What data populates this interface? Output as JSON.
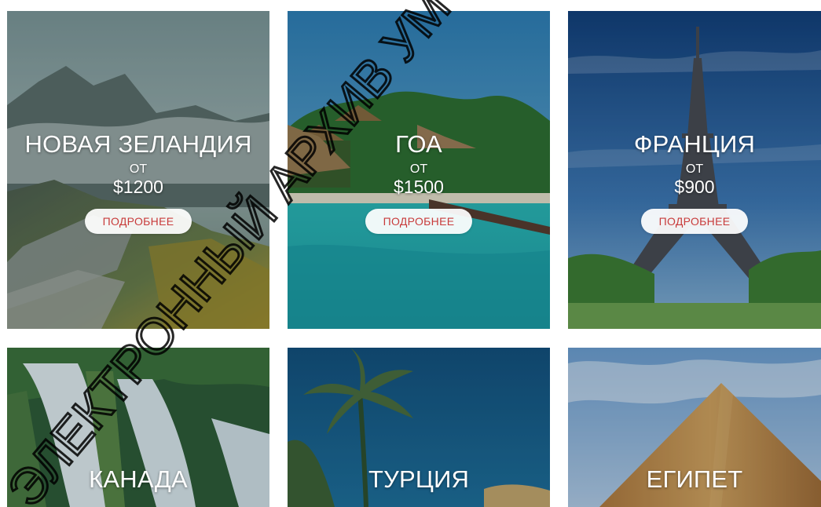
{
  "cards": [
    {
      "title": "НОВАЯ ЗЕЛАНДИЯ",
      "from": "ОТ",
      "price": "$1200",
      "button": "ПОДРОБНЕЕ"
    },
    {
      "title": "ГОА",
      "from": "ОТ",
      "price": "$1500",
      "button": "ПОДРОБНЕЕ"
    },
    {
      "title": "ФРАНЦИЯ",
      "from": "ОТ",
      "price": "$900",
      "button": "ПОДРОБНЕЕ"
    },
    {
      "title": "КАНАДА"
    },
    {
      "title": "ТУРЦИЯ"
    },
    {
      "title": "ЕГИПЕТ"
    }
  ],
  "watermark": {
    "text": "ЭЛЕКТРОННЫЙ АРХИВ УМ ИМ"
  },
  "colors": {
    "button_text": "#c83b3b",
    "button_bg": "#ffffff",
    "title_text": "#ffffff"
  },
  "icons": {
    "card_images": [
      "mountain-landscape-image",
      "tropical-beach-image",
      "eiffel-tower-image",
      "waterfall-image",
      "palm-trees-image",
      "pyramid-image"
    ]
  }
}
